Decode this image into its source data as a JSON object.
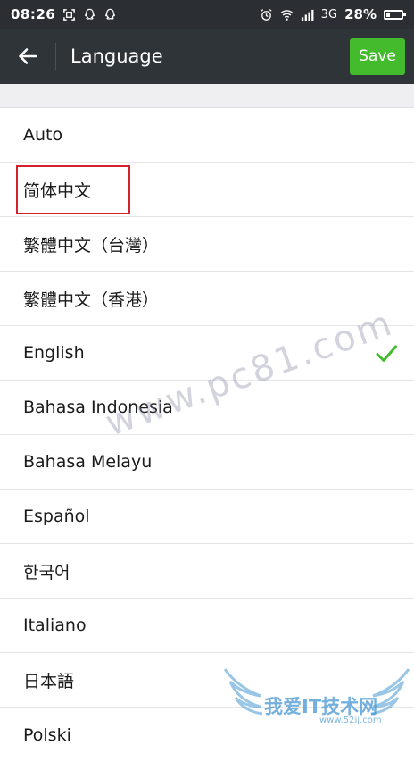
{
  "status_bar": {
    "time": "08:26",
    "network": "3G",
    "battery": "28%",
    "battery_level": 0.28
  },
  "app_bar": {
    "title": "Language",
    "save_label": "Save"
  },
  "languages": [
    {
      "label": "Auto"
    },
    {
      "label": "简体中文"
    },
    {
      "label": "繁體中文（台灣）"
    },
    {
      "label": "繁體中文（香港）"
    },
    {
      "label": "English",
      "selected": true
    },
    {
      "label": "Bahasa Indonesia"
    },
    {
      "label": "Bahasa Melayu"
    },
    {
      "label": "Español"
    },
    {
      "label": "한국어"
    },
    {
      "label": "Italiano"
    },
    {
      "label": "日本語"
    },
    {
      "label": "Polski"
    }
  ],
  "watermarks": {
    "site": "www.pc81.com",
    "logo_text": "我爱IT技术网",
    "logo_sub": "www.52ij.com"
  },
  "colors": {
    "accent_green": "#44bb2d",
    "app_bar": "#2f3438",
    "highlight_red": "#d5202e"
  }
}
